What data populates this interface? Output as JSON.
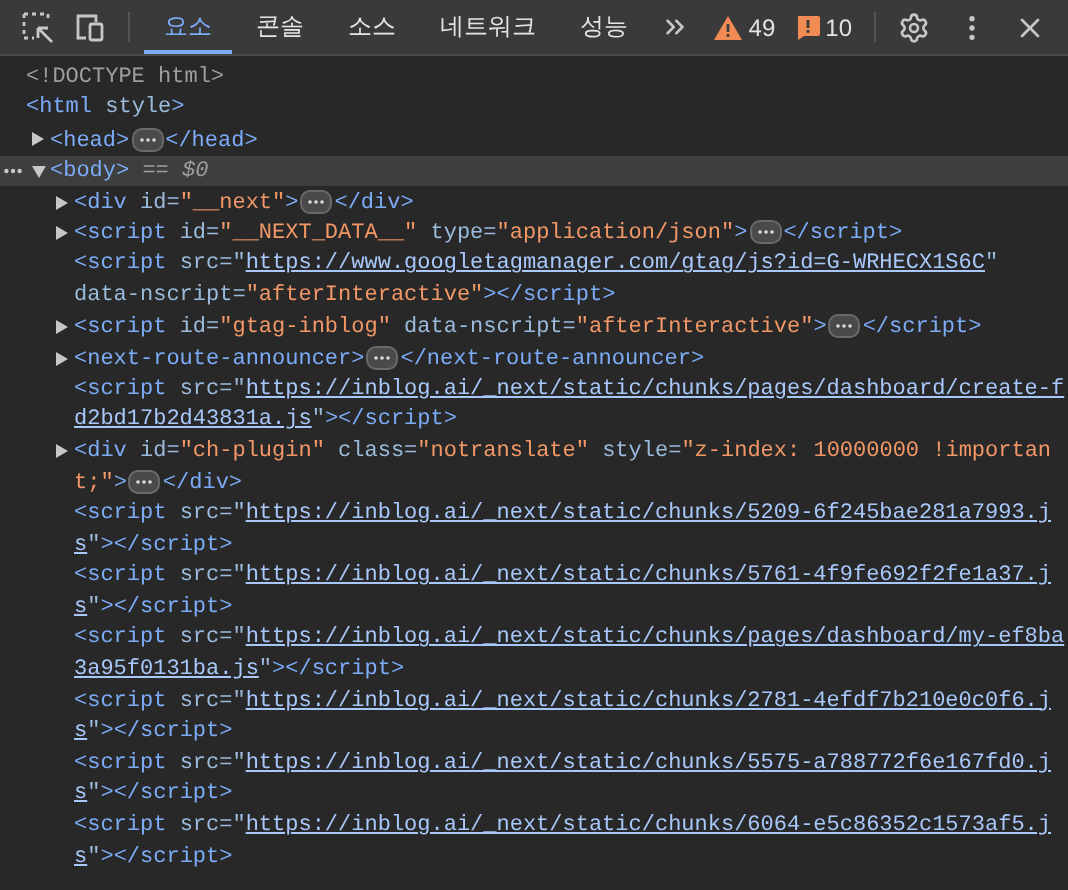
{
  "toolbar": {
    "tabs": [
      {
        "label": "요소",
        "selected": true
      },
      {
        "label": "콘솔",
        "selected": false
      },
      {
        "label": "소스",
        "selected": false
      },
      {
        "label": "네트워크",
        "selected": false
      },
      {
        "label": "성능",
        "selected": false
      }
    ],
    "counters": [
      {
        "kind": "warning",
        "count": "49"
      },
      {
        "kind": "issue",
        "count": "10"
      }
    ]
  },
  "dom": [
    {
      "selected": false,
      "lines": [
        [
          {
            "kind": "doctype",
            "text": "<!DOCTYPE html>"
          }
        ]
      ]
    },
    {
      "selected": false,
      "lines": [
        [
          {
            "kind": "tag",
            "text": "<html"
          },
          {
            "kind": "attr",
            "text": " style"
          },
          {
            "kind": "tag",
            "text": ">"
          }
        ]
      ],
      "children": [
        {
          "selected": false,
          "expanded": false,
          "lines": [
            [
              {
                "kind": "tag",
                "text": "<head>"
              },
              {
                "kind": "ellipsis"
              },
              {
                "kind": "tag",
                "text": "</head>"
              }
            ]
          ]
        },
        {
          "selected": true,
          "expanded": true,
          "lines": [
            [
              {
                "kind": "tag",
                "text": "<body>"
              },
              {
                "kind": "console",
                "text": " == *$0*"
              }
            ]
          ],
          "children": [
            {
              "selected": false,
              "expanded": false,
              "lines": [
                [
                  {
                    "kind": "tag",
                    "text": "<div"
                  },
                  {
                    "kind": "attr",
                    "text": " id="
                  },
                  {
                    "kind": "value",
                    "text": "\"__next\""
                  },
                  {
                    "kind": "tag",
                    "text": ">"
                  },
                  {
                    "kind": "ellipsis"
                  },
                  {
                    "kind": "tag",
                    "text": "</div>"
                  }
                ]
              ]
            },
            {
              "selected": false,
              "expanded": false,
              "lines": [
                [
                  {
                    "kind": "tag",
                    "text": "<script"
                  },
                  {
                    "kind": "attr",
                    "text": " id="
                  },
                  {
                    "kind": "value",
                    "text": "\"__NEXT_DATA__\""
                  },
                  {
                    "kind": "attr",
                    "text": " type="
                  },
                  {
                    "kind": "value",
                    "text": "\"application/json\""
                  },
                  {
                    "kind": "tag",
                    "text": ">"
                  },
                  {
                    "kind": "ellipsis"
                  },
                  {
                    "kind": "tag",
                    "text": "</script>"
                  }
                ]
              ]
            },
            {
              "selected": false,
              "lines": [
                [
                  {
                    "kind": "tag",
                    "text": "<script"
                  },
                  {
                    "kind": "attr",
                    "text": " src=\""
                  },
                  {
                    "kind": "link",
                    "text": "https://www.googletagmanager.com/gtag/js?id=G-WRHECX1S6C"
                  },
                  {
                    "kind": "attr",
                    "text": "\""
                  }
                ],
                [
                  {
                    "kind": "attr",
                    "text": "data-nscript="
                  },
                  {
                    "kind": "value",
                    "text": "\"afterInteractive\""
                  },
                  {
                    "kind": "tag",
                    "text": "></script>"
                  }
                ]
              ]
            },
            {
              "selected": false,
              "expanded": false,
              "lines": [
                [
                  {
                    "kind": "tag",
                    "text": "<script"
                  },
                  {
                    "kind": "attr",
                    "text": " id="
                  },
                  {
                    "kind": "value",
                    "text": "\"gtag-inblog\""
                  },
                  {
                    "kind": "attr",
                    "text": " data-nscript="
                  },
                  {
                    "kind": "value",
                    "text": "\"afterInteractive\""
                  },
                  {
                    "kind": "tag",
                    "text": ">"
                  },
                  {
                    "kind": "ellipsis"
                  },
                  {
                    "kind": "tag",
                    "text": "</script>"
                  }
                ]
              ]
            },
            {
              "selected": false,
              "expanded": false,
              "lines": [
                [
                  {
                    "kind": "tag",
                    "text": "<next-route-announcer>"
                  },
                  {
                    "kind": "ellipsis"
                  },
                  {
                    "kind": "tag",
                    "text": "</next-route-announcer>"
                  }
                ]
              ]
            },
            {
              "selected": false,
              "lines": [
                [
                  {
                    "kind": "tag",
                    "text": "<script"
                  },
                  {
                    "kind": "attr",
                    "text": " src=\""
                  },
                  {
                    "kind": "link",
                    "text": "https://inblog.ai/_next/static/chunks/pages/dashboard/create-f"
                  }
                ],
                [
                  {
                    "kind": "link",
                    "text": "d2bd17b2d43831a.js"
                  },
                  {
                    "kind": "attr",
                    "text": "\""
                  },
                  {
                    "kind": "tag",
                    "text": "></script>"
                  }
                ]
              ]
            },
            {
              "selected": false,
              "expanded": false,
              "lines": [
                [
                  {
                    "kind": "tag",
                    "text": "<div"
                  },
                  {
                    "kind": "attr",
                    "text": " id="
                  },
                  {
                    "kind": "value",
                    "text": "\"ch-plugin\""
                  },
                  {
                    "kind": "attr",
                    "text": " class="
                  },
                  {
                    "kind": "value",
                    "text": "\"notranslate\""
                  },
                  {
                    "kind": "attr",
                    "text": " style="
                  },
                  {
                    "kind": "value",
                    "text": "\"z-index: 10000000 !importan"
                  }
                ],
                [
                  {
                    "kind": "value",
                    "text": "t;\""
                  },
                  {
                    "kind": "tag",
                    "text": ">"
                  },
                  {
                    "kind": "ellipsis"
                  },
                  {
                    "kind": "tag",
                    "text": "</div>"
                  }
                ]
              ]
            },
            {
              "selected": false,
              "lines": [
                [
                  {
                    "kind": "tag",
                    "text": "<script"
                  },
                  {
                    "kind": "attr",
                    "text": " src=\""
                  },
                  {
                    "kind": "link",
                    "text": "https://inblog.ai/_next/static/chunks/5209-6f245bae281a7993.j"
                  }
                ],
                [
                  {
                    "kind": "link",
                    "text": "s"
                  },
                  {
                    "kind": "attr",
                    "text": "\""
                  },
                  {
                    "kind": "tag",
                    "text": "></script>"
                  }
                ]
              ]
            },
            {
              "selected": false,
              "lines": [
                [
                  {
                    "kind": "tag",
                    "text": "<script"
                  },
                  {
                    "kind": "attr",
                    "text": " src=\""
                  },
                  {
                    "kind": "link",
                    "text": "https://inblog.ai/_next/static/chunks/5761-4f9fe692f2fe1a37.j"
                  }
                ],
                [
                  {
                    "kind": "link",
                    "text": "s"
                  },
                  {
                    "kind": "attr",
                    "text": "\""
                  },
                  {
                    "kind": "tag",
                    "text": "></script>"
                  }
                ]
              ]
            },
            {
              "selected": false,
              "lines": [
                [
                  {
                    "kind": "tag",
                    "text": "<script"
                  },
                  {
                    "kind": "attr",
                    "text": " src=\""
                  },
                  {
                    "kind": "link",
                    "text": "https://inblog.ai/_next/static/chunks/pages/dashboard/my-ef8ba"
                  }
                ],
                [
                  {
                    "kind": "link",
                    "text": "3a95f0131ba.js"
                  },
                  {
                    "kind": "attr",
                    "text": "\""
                  },
                  {
                    "kind": "tag",
                    "text": "></script>"
                  }
                ]
              ]
            },
            {
              "selected": false,
              "lines": [
                [
                  {
                    "kind": "tag",
                    "text": "<script"
                  },
                  {
                    "kind": "attr",
                    "text": " src=\""
                  },
                  {
                    "kind": "link",
                    "text": "https://inblog.ai/_next/static/chunks/2781-4efdf7b210e0c0f6.j"
                  }
                ],
                [
                  {
                    "kind": "link",
                    "text": "s"
                  },
                  {
                    "kind": "attr",
                    "text": "\""
                  },
                  {
                    "kind": "tag",
                    "text": "></script>"
                  }
                ]
              ]
            },
            {
              "selected": false,
              "lines": [
                [
                  {
                    "kind": "tag",
                    "text": "<script"
                  },
                  {
                    "kind": "attr",
                    "text": " src=\""
                  },
                  {
                    "kind": "link",
                    "text": "https://inblog.ai/_next/static/chunks/5575-a788772f6e167fd0.j"
                  }
                ],
                [
                  {
                    "kind": "link",
                    "text": "s"
                  },
                  {
                    "kind": "attr",
                    "text": "\""
                  },
                  {
                    "kind": "tag",
                    "text": "></script>"
                  }
                ]
              ]
            },
            {
              "selected": false,
              "lines": [
                [
                  {
                    "kind": "tag",
                    "text": "<script"
                  },
                  {
                    "kind": "attr",
                    "text": " src=\""
                  },
                  {
                    "kind": "link",
                    "text": "https://inblog.ai/_next/static/chunks/6064-e5c86352c1573af5.j"
                  }
                ],
                [
                  {
                    "kind": "link",
                    "text": "s"
                  },
                  {
                    "kind": "attr",
                    "text": "\""
                  },
                  {
                    "kind": "tag",
                    "text": "></script>"
                  }
                ]
              ]
            }
          ]
        }
      ]
    }
  ]
}
